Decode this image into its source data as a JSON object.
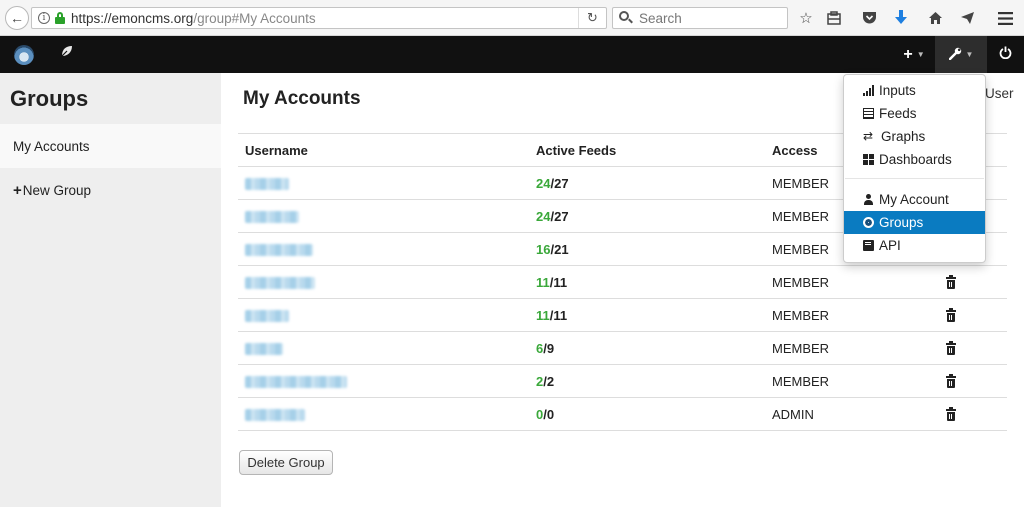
{
  "browser": {
    "url_host": "https://emoncms.org",
    "url_path": "/group#My Accounts",
    "search_placeholder": "Search"
  },
  "sidebar": {
    "title": "Groups",
    "items": [
      {
        "label": "My Accounts",
        "active": true
      },
      {
        "label": "New Group",
        "active": false
      }
    ]
  },
  "main": {
    "title": "My Accounts",
    "user_fragment": "User",
    "delete_group_label": "Delete Group",
    "columns": [
      "Username",
      "Active Feeds",
      "Access"
    ],
    "rows": [
      {
        "active": "24",
        "total": "27",
        "access": "MEMBER",
        "blur_width": 44
      },
      {
        "active": "24",
        "total": "27",
        "access": "MEMBER",
        "blur_width": 54
      },
      {
        "active": "16",
        "total": "21",
        "access": "MEMBER",
        "blur_width": 68
      },
      {
        "active": "11",
        "total": "11",
        "access": "MEMBER",
        "blur_width": 70
      },
      {
        "active": "11",
        "total": "11",
        "access": "MEMBER",
        "blur_width": 44
      },
      {
        "active": "6",
        "total": "9",
        "access": "MEMBER",
        "blur_width": 38
      },
      {
        "active": "2",
        "total": "2",
        "access": "MEMBER",
        "blur_width": 102
      },
      {
        "active": "0",
        "total": "0",
        "access": "ADMIN",
        "blur_width": 60
      }
    ]
  },
  "dropdown": {
    "items": [
      {
        "label": "Inputs",
        "icon": "signal-icon"
      },
      {
        "label": "Feeds",
        "icon": "list-icon"
      },
      {
        "label": "Graphs",
        "icon": "retweet-icon"
      },
      {
        "label": "Dashboards",
        "icon": "grid-icon"
      },
      {
        "label": "My Account",
        "icon": "user-icon"
      },
      {
        "label": "Groups",
        "icon": "globe-icon",
        "active": true
      },
      {
        "label": "API",
        "icon": "book-icon"
      }
    ]
  },
  "colors": {
    "navbar": "#111111",
    "active_feeds": "#3aa83a",
    "dropdown_active": "#0a7bc1",
    "sidebar_bg": "#eeeeee"
  }
}
